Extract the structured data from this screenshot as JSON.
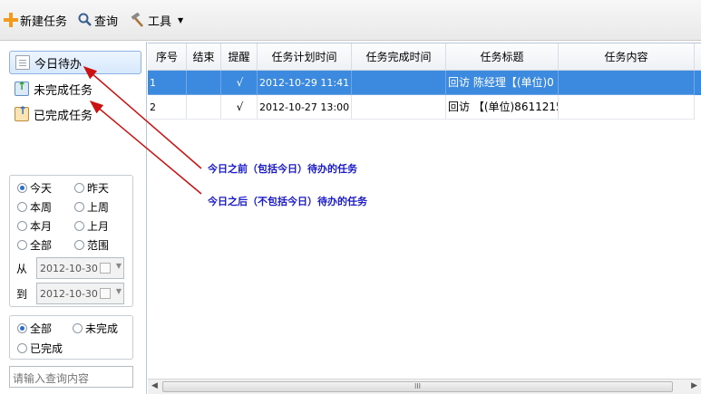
{
  "toolbar": {
    "new_task": "新建任务",
    "query": "查询",
    "tools": "工具"
  },
  "nav": {
    "today": "今日待办",
    "incomplete": "未完成任务",
    "completed": "已完成任务"
  },
  "date_filter": {
    "options": [
      "今天",
      "昨天",
      "本周",
      "上周",
      "本月",
      "上月",
      "全部",
      "范围"
    ],
    "selected": "今天",
    "from_label": "从",
    "from_value": "2012-10-30",
    "to_label": "到",
    "to_value": "2012-10-30"
  },
  "status_filter": {
    "options": [
      "全部",
      "未完成",
      "已完成"
    ],
    "selected": "全部"
  },
  "search": {
    "placeholder": "请输入查询内容"
  },
  "table": {
    "columns": [
      "序号",
      "结束",
      "提醒",
      "任务计划时间",
      "任务完成时间",
      "任务标题",
      "任务内容"
    ],
    "rows": [
      {
        "seq": "1",
        "end": "",
        "remind": "√",
        "plan_time": "2012-10-29 11:41",
        "done_time": "",
        "title": "回访 陈经理【(单位)0",
        "content": ""
      },
      {
        "seq": "2",
        "end": "",
        "remind": "√",
        "plan_time": "2012-10-27 13:00",
        "done_time": "",
        "title": "回访 【(单位)8611215",
        "content": ""
      }
    ],
    "selected_row": 0
  },
  "scrollbar": {
    "grip": "III"
  },
  "annotations": {
    "note1": "今日之前（包括今日）待办的任务",
    "note2": "今日之后（不包括今日）待办的任务"
  },
  "colors": {
    "selection": "#3c8ae0",
    "arrow": "#cc1111",
    "annotation_text": "#1a1acc",
    "accent": "#f29a1b"
  }
}
